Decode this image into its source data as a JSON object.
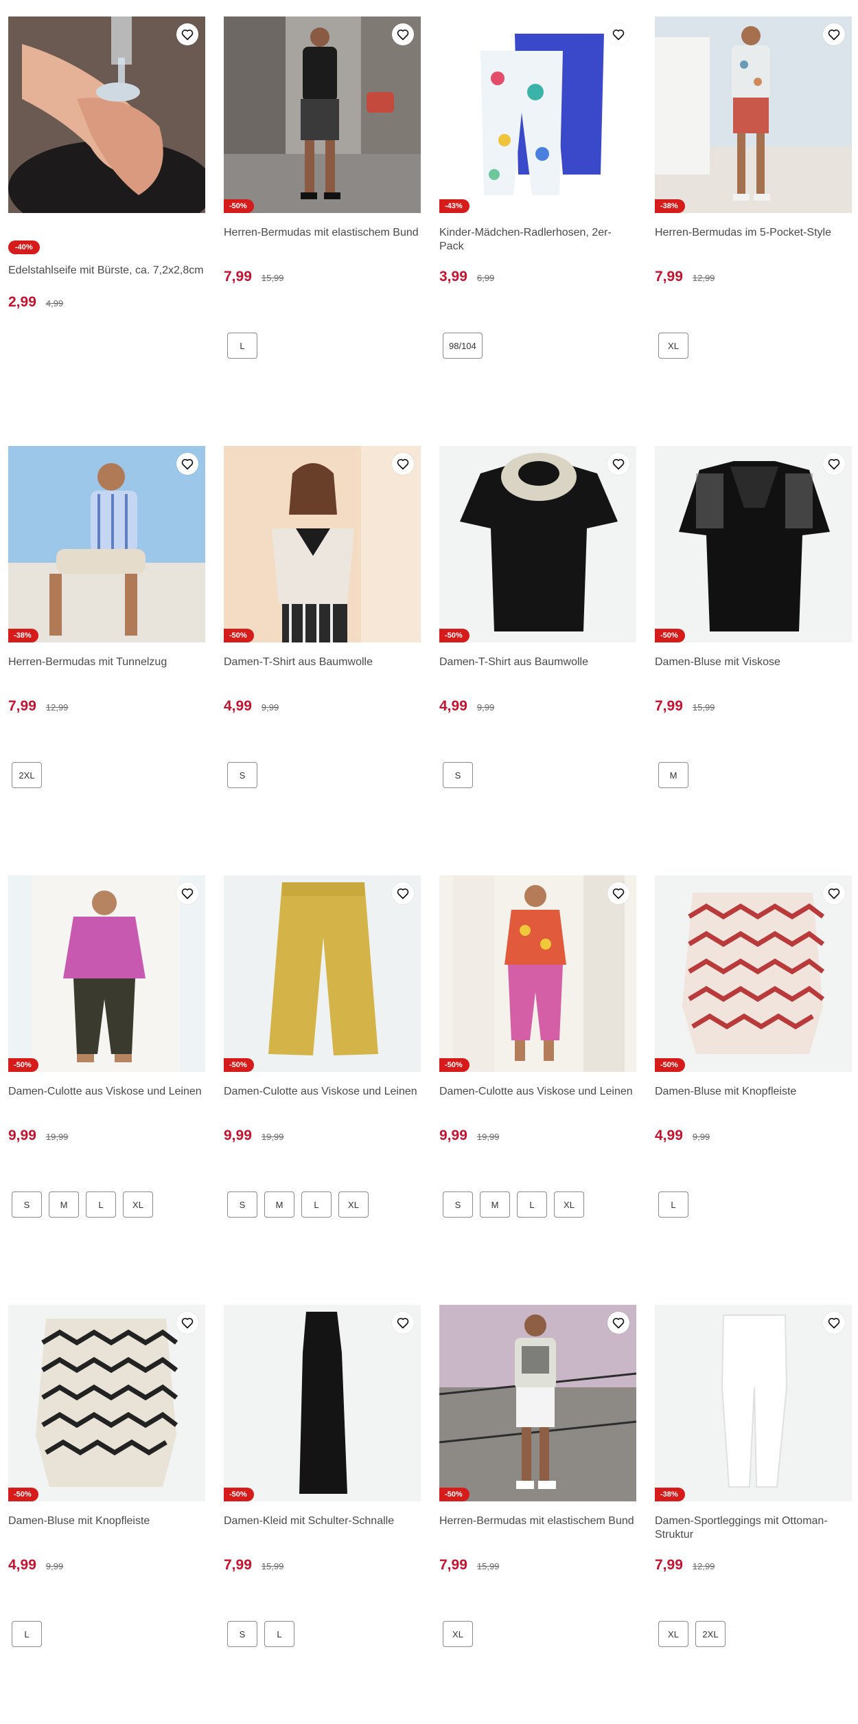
{
  "accent_color": "#c4122f",
  "badge_color": "#d61b1b",
  "favorite_icon": "heart-outline-icon",
  "products": [
    {
      "title": "Edelstahlseife mit Bürste, ca. 7,2x2,8cm",
      "discount": "-40%",
      "price": "2,99",
      "old_price": "4,99",
      "sizes": [],
      "image": "hands-soap",
      "badge_standalone": true
    },
    {
      "title": "Herren-Bermudas mit elastischem Bund",
      "discount": "-50%",
      "price": "7,99",
      "old_price": "15,99",
      "sizes": [
        "L"
      ],
      "image": "man-street-dark"
    },
    {
      "title": "Kinder-Mädchen-Radlerhosen, 2er-Pack",
      "discount": "-43%",
      "price": "3,99",
      "old_price": "6,99",
      "sizes": [
        "98/104"
      ],
      "image": "kids-shorts"
    },
    {
      "title": "Herren-Bermudas im 5-Pocket-Style",
      "discount": "-38%",
      "price": "7,99",
      "old_price": "12,99",
      "sizes": [
        "XL"
      ],
      "image": "man-terrace"
    },
    {
      "title": "Herren-Bermudas mit Tunnelzug",
      "discount": "-38%",
      "price": "7,99",
      "old_price": "12,99",
      "sizes": [
        "2XL"
      ],
      "image": "man-sitting"
    },
    {
      "title": "Damen-T-Shirt aus Baumwolle",
      "discount": "-50%",
      "price": "4,99",
      "old_price": "9,99",
      "sizes": [
        "S"
      ],
      "image": "woman-tshirt"
    },
    {
      "title": "Damen-T-Shirt aus Baumwolle",
      "discount": "-50%",
      "price": "4,99",
      "old_price": "9,99",
      "sizes": [
        "S"
      ],
      "image": "black-top-lace"
    },
    {
      "title": "Damen-Bluse mit Viskose",
      "discount": "-50%",
      "price": "7,99",
      "old_price": "15,99",
      "sizes": [
        "M"
      ],
      "image": "black-top-crochet"
    },
    {
      "title": "Damen-Culotte aus Viskose und Leinen",
      "discount": "-50%",
      "price": "9,99",
      "old_price": "19,99",
      "sizes": [
        "S",
        "M",
        "L",
        "XL"
      ],
      "image": "woman-pink"
    },
    {
      "title": "Damen-Culotte aus Viskose und Leinen",
      "discount": "-50%",
      "price": "9,99",
      "old_price": "19,99",
      "sizes": [
        "S",
        "M",
        "L",
        "XL"
      ],
      "image": "yellow-pants"
    },
    {
      "title": "Damen-Culotte aus Viskose und Leinen",
      "discount": "-50%",
      "price": "9,99",
      "old_price": "19,99",
      "sizes": [
        "S",
        "M",
        "L",
        "XL"
      ],
      "image": "woman-pink-pants"
    },
    {
      "title": "Damen-Bluse mit Knopfleiste",
      "discount": "-50%",
      "price": "4,99",
      "old_price": "9,99",
      "sizes": [
        "L"
      ],
      "image": "zigzag-red"
    },
    {
      "title": "Damen-Bluse mit Knopfleiste",
      "discount": "-50%",
      "price": "4,99",
      "old_price": "9,99",
      "sizes": [
        "L"
      ],
      "image": "zigzag-black"
    },
    {
      "title": "Damen-Kleid mit Schulter-Schnalle",
      "discount": "-50%",
      "price": "7,99",
      "old_price": "15,99",
      "sizes": [
        "S",
        "L"
      ],
      "image": "black-dress"
    },
    {
      "title": "Herren-Bermudas mit elastischem Bund",
      "discount": "-50%",
      "price": "7,99",
      "old_price": "15,99",
      "sizes": [
        "XL"
      ],
      "image": "man-fence"
    },
    {
      "title": "Damen-Sportleggings mit Ottoman-Struktur",
      "discount": "-38%",
      "price": "7,99",
      "old_price": "12,99",
      "sizes": [
        "XL",
        "2XL"
      ],
      "image": "white-leggings"
    }
  ]
}
